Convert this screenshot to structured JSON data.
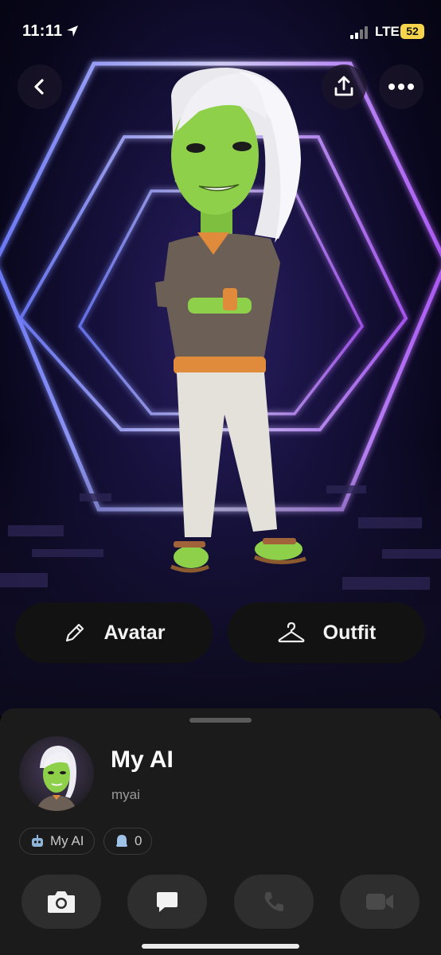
{
  "status_bar": {
    "time": "11:11",
    "network": "LTE",
    "battery": "52",
    "battery_color": "#f5d34a"
  },
  "top_bar": {
    "back_icon": "chevron-left-icon",
    "share_icon": "share-icon",
    "more_icon": "more-horizontal-icon"
  },
  "actions": {
    "avatar_label": "Avatar",
    "avatar_icon": "pencil-icon",
    "outfit_label": "Outfit",
    "outfit_icon": "hanger-icon"
  },
  "profile": {
    "display_name": "My AI",
    "username": "myai",
    "chips": [
      {
        "icon": "robot-icon",
        "label": "My AI"
      },
      {
        "icon": "ghost-icon",
        "label": "0"
      }
    ]
  },
  "bottom_actions": [
    {
      "icon": "camera-icon",
      "enabled": true
    },
    {
      "icon": "chat-icon",
      "enabled": true
    },
    {
      "icon": "phone-icon",
      "enabled": false
    },
    {
      "icon": "video-icon",
      "enabled": false
    }
  ],
  "colors": {
    "neon_blue": "#6f7dff",
    "neon_purple": "#b35cff",
    "skin": "#8ed04a",
    "sheet": "#1b1b1b"
  }
}
